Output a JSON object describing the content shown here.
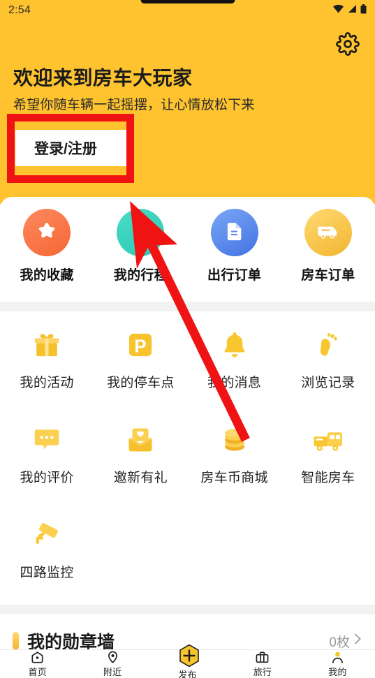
{
  "statusbar": {
    "time": "2:54",
    "icons": [
      "wifi-icon",
      "signal-icon",
      "battery-icon"
    ]
  },
  "header": {
    "background_color": "#FEC32E",
    "settings_icon": "gear-icon",
    "title": "欢迎来到房车大玩家",
    "subtitle": "希望你随车辆一起摇摆，让心情放松下来",
    "login_button": "登录/注册"
  },
  "shortcuts": [
    {
      "label": "我的收藏",
      "icon": "star-icon",
      "color": "#F96635"
    },
    {
      "label": "我的行程",
      "icon": "location-pin-icon",
      "color": "#2FC9B4"
    },
    {
      "label": "出行订单",
      "icon": "document-icon",
      "color": "#4272E4"
    },
    {
      "label": "房车订单",
      "icon": "rv-van-icon",
      "color": "#F2B530"
    }
  ],
  "menu_rows": [
    [
      {
        "label": "我的活动",
        "icon": "gift-icon"
      },
      {
        "label": "我的停车点",
        "icon": "parking-p-icon"
      },
      {
        "label": "我的消息",
        "icon": "bell-icon"
      },
      {
        "label": "浏览记录",
        "icon": "footprint-icon"
      }
    ],
    [
      {
        "label": "我的评价",
        "icon": "chat-bubble-icon"
      },
      {
        "label": "邀新有礼",
        "icon": "envelope-heart-icon"
      },
      {
        "label": "房车币商城",
        "icon": "coin-stack-icon"
      },
      {
        "label": "智能房车",
        "icon": "smart-rv-icon"
      }
    ],
    [
      {
        "label": "四路监控",
        "icon": "cctv-camera-icon"
      },
      {
        "label": "",
        "icon": ""
      },
      {
        "label": "",
        "icon": ""
      },
      {
        "label": "",
        "icon": ""
      }
    ]
  ],
  "medal_wall": {
    "title": "我的勋章墙",
    "count": "0枚",
    "chevron": "chevron-right-icon"
  },
  "bottom_nav": [
    {
      "label": "首页",
      "icon": "home-icon",
      "active": false
    },
    {
      "label": "附近",
      "icon": "nearby-pin-icon",
      "active": false
    },
    {
      "label": "发布",
      "icon": "publish-plus-icon",
      "active": false
    },
    {
      "label": "旅行",
      "icon": "suitcase-icon",
      "active": false
    },
    {
      "label": "我的",
      "icon": "person-icon",
      "active": true
    }
  ],
  "annotations": {
    "highlight_color": "#F01313",
    "box_target": "登录/注册",
    "arrow_target": "我的行程"
  }
}
